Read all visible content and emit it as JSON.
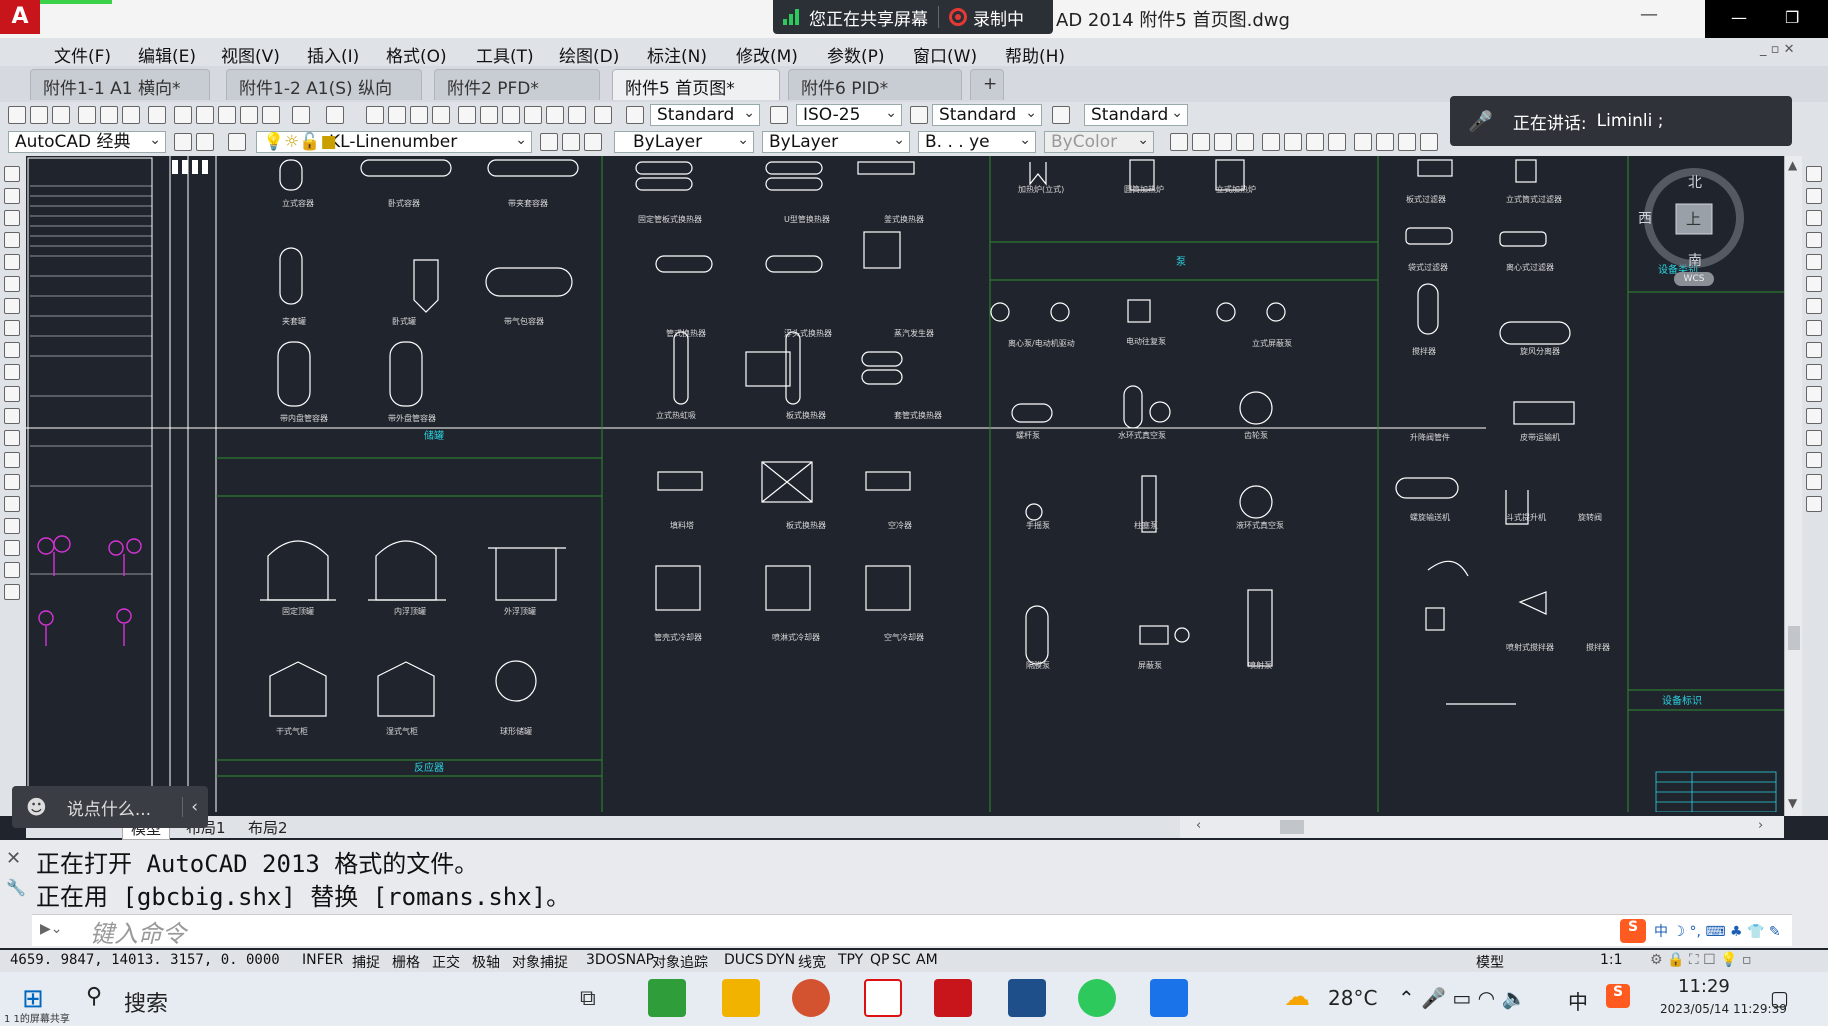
{
  "titlebar": {
    "share_text": "您正在共享屏幕",
    "record_text": "录制中",
    "window_title": "AD 2014    附件5 首页图.dwg"
  },
  "menubar": {
    "items": [
      "文件(F)",
      "编辑(E)",
      "视图(V)",
      "插入(I)",
      "格式(O)",
      "工具(T)",
      "绘图(D)",
      "标注(N)",
      "修改(M)",
      "参数(P)",
      "窗口(W)",
      "帮助(H)"
    ]
  },
  "tabs": [
    {
      "label": "附件1-1 A1 横向*"
    },
    {
      "label": "附件1-2 A1(S) 纵向"
    },
    {
      "label": "附件2 PFD*"
    },
    {
      "label": "附件5 首页图*"
    },
    {
      "label": "附件6 PID*"
    }
  ],
  "toolbar1": {
    "text_style": "Standard",
    "dim_style": "ISO-25",
    "table_style": "Standard",
    "multileader_style": "Standard"
  },
  "toolbar2": {
    "workspace": "AutoCAD 经典",
    "layer": "KL-Linenumber",
    "color": "ByLayer",
    "linetype": "ByLayer",
    "lineweight": "B. . . ye",
    "plotstyle": "ByColor"
  },
  "speaking": {
    "label": "正在讲话:",
    "name": "Liminli ;"
  },
  "layout_tabs": [
    "模型",
    "布局1",
    "布局2"
  ],
  "chat": {
    "placeholder": "说点什么..."
  },
  "command": {
    "history": [
      "正在打开 AutoCAD 2013 格式的文件。",
      "正在用 [gbcbig.shx] 替换 [romans.shx]。"
    ],
    "placeholder": "键入命令"
  },
  "status": {
    "coords": "4659. 9847,  14013. 3157,  0. 0000",
    "toggles": [
      "INFER",
      "捕捉",
      "栅格",
      "正交",
      "极轴",
      "对象捕捉",
      "3DOSNAP",
      "对象追踪",
      "DUCS",
      "DYN",
      "线宽",
      "TPY",
      "QP",
      "SC",
      "AM"
    ],
    "model": "模型",
    "scale": "1:1"
  },
  "viewcube": {
    "north": "北",
    "south": "南",
    "west": "西",
    "face": "上",
    "wcs": "WCS"
  },
  "drawing": {
    "sections": [
      "储罐",
      "反应器",
      "泵",
      "设备类别",
      "设备标识"
    ],
    "labels": {
      "col1": [
        "立式容器",
        "卧式容器",
        "带夹套容器",
        "夹套罐",
        "卧式罐",
        "带气包容器",
        "带内盘管容器",
        "带外盘管容器",
        "固定顶罐",
        "内浮顶罐",
        "外浮顶罐",
        "干式气柜",
        "湿式气柜",
        "球形储罐"
      ],
      "col2": [
        "固定管板式换热器",
        "U型管换热器",
        "釜式换热器",
        "管式换热器",
        "浮头式换热器",
        "蒸汽发生器",
        "立式热虹吸",
        "板式换热器",
        "套管式换热器",
        "填料塔",
        "板式换热器",
        "空冷器",
        "管壳式冷却器",
        "喷淋式冷却器",
        "空气冷却器"
      ],
      "col3": [
        "加热炉(立式)",
        "圆筒加热炉",
        "立式加热炉",
        "离心泵/电动机驱动",
        "电动往复泵",
        "立式屏蔽泵",
        "螺杆泵",
        "水环式真空泵",
        "齿轮泵",
        "手摇泵",
        "柱塞泵",
        "液环式真空泵",
        "隔膜泵",
        "屏蔽泵",
        "喷射泵"
      ],
      "col4": [
        "板式过滤器",
        "立式筒式过滤器",
        "袋式过滤器",
        "离心式过滤器",
        "搅拌器",
        "旋风分离器",
        "升降阀管件",
        "皮带运输机",
        "螺旋输送机",
        "斗式提升机",
        "旋转阀",
        "喷射式搅拌器",
        "搅拌器"
      ]
    }
  },
  "taskbar": {
    "search": "搜索",
    "weather": "28°C",
    "ime": "中",
    "time": "11:29",
    "date": "2023/05/14 11:29:39",
    "share_note": "1 1的屏幕共享"
  }
}
